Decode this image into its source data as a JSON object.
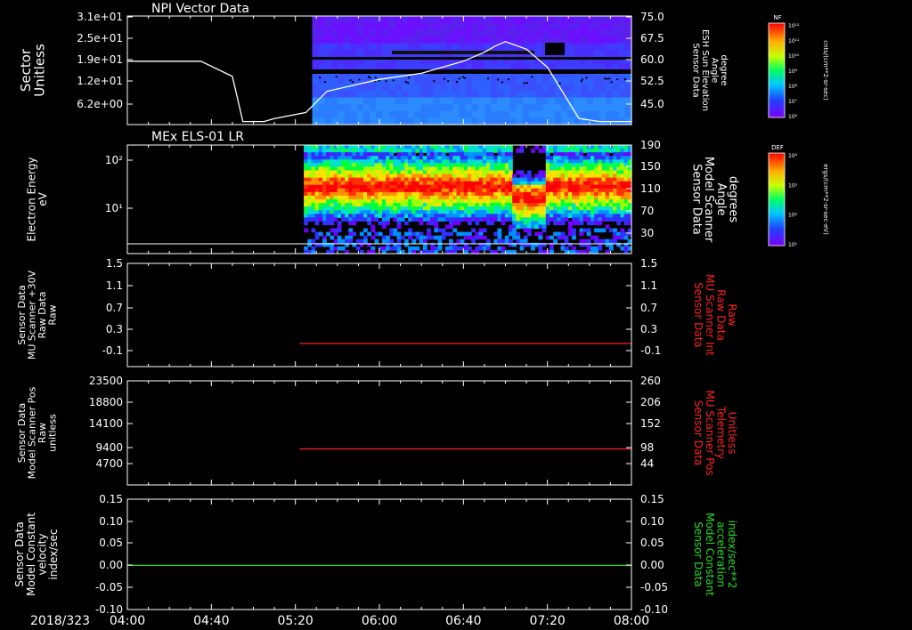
{
  "colors": {
    "white": "#ffffff",
    "red": "#ff2020",
    "green": "#22dd22",
    "background": "#000000"
  },
  "date_label": "2018/323",
  "x_ticks": [
    "04:00",
    "04:40",
    "05:20",
    "06:00",
    "06:40",
    "07:20",
    "08:00"
  ],
  "chart_data": [
    {
      "type": "heatmap",
      "title": "NPI Vector Data",
      "ylabel": "Sector\nUnitless",
      "y_ticks": [
        "3.1e+01",
        "2.5e+01",
        "1.9e+01",
        "1.2e+01",
        "6.2e+00"
      ],
      "y2label": "Sensor Data\nESH Sun Elevation\nAngle\ndegree",
      "y2_ticks": [
        "75.0",
        "67.5",
        "60.0",
        "52.5",
        "45.0"
      ],
      "y2lim": [
        39.0,
        75.0
      ],
      "x_range": [
        "04:00",
        "08:00"
      ],
      "data_start": "05:28",
      "overlay_line": {
        "name": "ESH Sun Elevation Angle",
        "x_min": [
          0,
          35,
          50,
          55,
          65,
          70,
          85,
          95,
          120,
          140,
          160,
          170,
          175,
          180,
          190,
          200,
          215,
          225,
          232,
          240
        ],
        "y_deg": [
          60,
          60,
          55,
          40,
          40,
          41,
          43,
          50,
          54,
          56,
          60,
          63,
          65,
          66.5,
          64,
          58,
          41,
          40,
          40,
          40
        ]
      },
      "colorbar": {
        "label": "NF",
        "units": "cnts/(cm**2-sr-sec)",
        "ticks": [
          "10¹²",
          "10¹¹",
          "10¹⁰",
          "10⁹",
          "10⁸",
          "10⁷",
          "10⁶"
        ]
      }
    },
    {
      "type": "heatmap",
      "title": "MEx ELS-01 LR",
      "ylabel": "Electron Energy\neV",
      "y_ticks": [
        "10²",
        "10¹"
      ],
      "y2label": "Sensor Data\nModel Scanner\nAngle\ndegrees",
      "y2_ticks": [
        "190",
        "150",
        "110",
        "70",
        "30"
      ],
      "x_range": [
        "04:00",
        "08:00"
      ],
      "data_start": "05:24",
      "colorbar": {
        "label": "DEF",
        "units": "ergs/(cm**2-sr-sec-eV)",
        "ticks": [
          "10⁴",
          "10³",
          "10²",
          "10¹"
        ]
      }
    },
    {
      "type": "line",
      "ylabel": "Sensor Data\nMU Scanner +30V\nRaw Data\nRaw",
      "y_ticks": [
        "1.5",
        "1.1",
        "0.7",
        "0.3",
        "-0.1"
      ],
      "ylim": [
        -0.3,
        1.5
      ],
      "y2label": "Sensor Data\nMU Scanner Int\nRaw Data\nRaw",
      "y2_ticks": [
        "1.5",
        "1.1",
        "0.7",
        "0.3",
        "-0.1"
      ],
      "series": [
        {
          "x_start": "05:22",
          "x_end": "08:00",
          "value": 0.0,
          "color": "#ff2020"
        }
      ]
    },
    {
      "type": "line",
      "ylabel": "Sensor Data\nModel Scanner Pos\nRaw\nunitless",
      "y_ticks": [
        "23500",
        "18800",
        "14100",
        "9400",
        "4700"
      ],
      "ylim": [
        0,
        23500
      ],
      "y2label": "Sensor Data\nMU Scanner Pos\nTelemetry\nUnitless",
      "y2_ticks": [
        "260",
        "206",
        "152",
        "98",
        "44"
      ],
      "y2lim": [
        0,
        260
      ],
      "series": [
        {
          "x_start": "05:22",
          "x_end": "08:00",
          "value": 90,
          "axis": "y2",
          "color": "#ff2020"
        }
      ]
    },
    {
      "type": "line",
      "ylabel": "Sensor Data\nModel Constant\nvelocity\nindex/sec",
      "y_ticks": [
        "0.15",
        "0.10",
        "0.05",
        "0.00",
        "-0.05",
        "-0.10"
      ],
      "ylim": [
        -0.1,
        0.15
      ],
      "y2label": "Sensor Data\nModel Constant\nacceleration\nindex/sec**2",
      "y2_ticks": [
        "0.15",
        "0.10",
        "0.05",
        "0.00",
        "-0.05",
        "-0.10"
      ],
      "series": [
        {
          "x_start": "04:00",
          "x_end": "08:00",
          "value": 0.0,
          "color": "#22dd22"
        }
      ]
    }
  ]
}
